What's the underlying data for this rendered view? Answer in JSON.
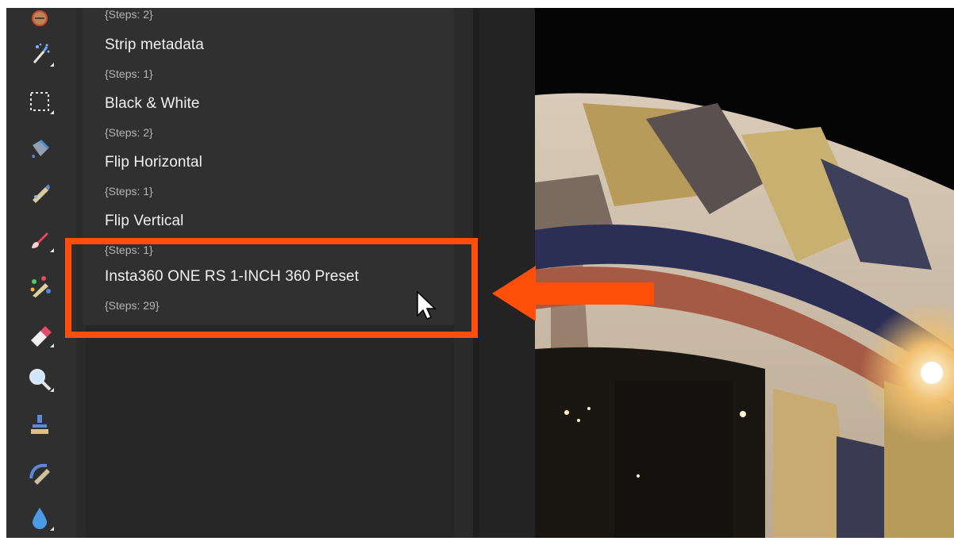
{
  "toolbar": {
    "tools": [
      {
        "icon": "brush-circle-icon"
      },
      {
        "icon": "magic-wand-icon"
      },
      {
        "icon": "marquee-selection-icon"
      },
      {
        "icon": "fill-bucket-icon"
      },
      {
        "icon": "pencil-edit-icon"
      },
      {
        "icon": "paint-brush-icon"
      },
      {
        "icon": "color-brush-icon"
      },
      {
        "icon": "eraser-icon"
      },
      {
        "icon": "zoom-icon"
      },
      {
        "icon": "stamp-icon"
      },
      {
        "icon": "recolor-brush-icon"
      },
      {
        "icon": "droplet-icon"
      }
    ]
  },
  "macros": [
    {
      "name": "",
      "steps": "{Steps: 2}"
    },
    {
      "name": "Strip metadata",
      "steps": "{Steps: 1}"
    },
    {
      "name": "Black & White",
      "steps": "{Steps: 2}"
    },
    {
      "name": "Flip Horizontal",
      "steps": "{Steps: 1}"
    },
    {
      "name": "Flip Vertical",
      "steps": "{Steps: 1}"
    },
    {
      "name": "Insta360 ONE RS 1-INCH 360 Preset",
      "steps": "{Steps: 29}"
    }
  ],
  "colors": {
    "accent": "#ff4f0a",
    "panel": "#303030",
    "background": "#2b2b2b"
  }
}
